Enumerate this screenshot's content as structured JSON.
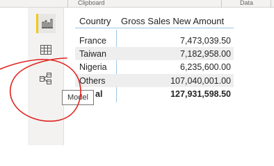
{
  "ribbon": {
    "groups": [
      "Clipboard",
      "Data"
    ]
  },
  "nav": {
    "items": [
      {
        "name": "report-view",
        "icon": "bar-chart-icon",
        "active": true
      },
      {
        "name": "data-view",
        "icon": "table-grid-icon",
        "active": false
      },
      {
        "name": "model-view",
        "icon": "model-icon",
        "active": false
      }
    ],
    "tooltip": "Model"
  },
  "table": {
    "headers": {
      "country": "Country",
      "amount": "Gross Sales New Amount"
    },
    "rows": [
      {
        "country": "France",
        "amount": "7,473,039.50"
      },
      {
        "country": "Taiwan",
        "amount": "7,182,958.00"
      },
      {
        "country": "Nigeria",
        "amount": "6,235,600.00"
      },
      {
        "country": "Others",
        "amount": "107,040,001.00"
      }
    ],
    "total": {
      "label": "Total",
      "visible_label": "al",
      "amount": "127,931,598.50"
    }
  },
  "colors": {
    "accent": "#f2c811",
    "grid_line": "#9cc7e6",
    "annotation": "#e0211d"
  }
}
